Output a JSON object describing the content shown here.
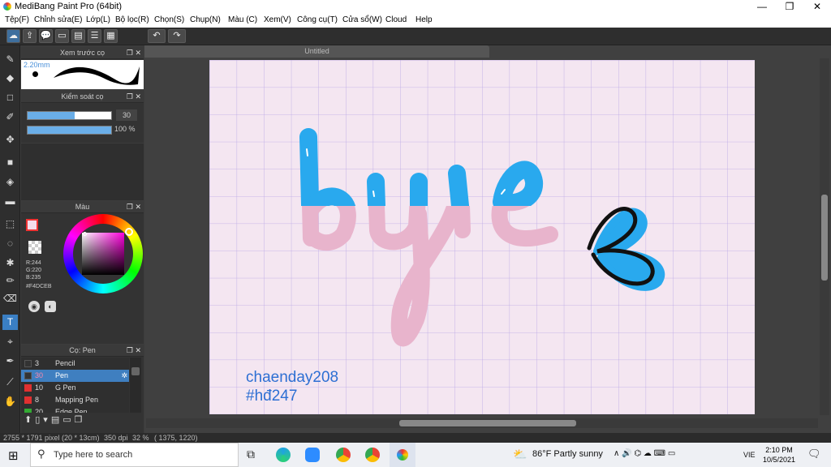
{
  "window": {
    "title": "MediBang Paint Pro (64bit)",
    "controls": [
      "—",
      "❐",
      "✕"
    ]
  },
  "menu": [
    "Tệp(F)",
    "Chỉnh sửa(E)",
    "Lớp(L)",
    "Bộ lọc(R)",
    "Chọn(S)",
    "Chụp(N)",
    "Màu (C)",
    "Xem(V)",
    "Công cụ(T)",
    "Cửa sổ(W)",
    "Cloud",
    "Help"
  ],
  "toolbar": {
    "undo_icon": "undo-icon",
    "redo_icon": "redo-icon"
  },
  "brush_preview": {
    "title": "Xem trước cọ",
    "size": "2.20mm"
  },
  "brush_control": {
    "title": "Kiểm soát cọ",
    "size_value": "30",
    "opacity_value": "100 %",
    "size_fraction": 0.56,
    "opacity_fraction": 1.0
  },
  "color_panel": {
    "title": "Màu",
    "r": "R:244",
    "g": "G:220",
    "b": "B:235",
    "hex": "#F4DCEB",
    "current_color": "#F4DCEB"
  },
  "brush_list": {
    "title": "Cọ: Pen",
    "items": [
      {
        "num": "3",
        "name": "Pencil",
        "color": "#333333"
      },
      {
        "num": "30",
        "name": "Pen",
        "color": "#333333",
        "selected": true
      },
      {
        "num": "10",
        "name": "G Pen",
        "color": "#e03030"
      },
      {
        "num": "8",
        "name": "Mapping Pen",
        "color": "#e03030"
      },
      {
        "num": "20",
        "name": "Edge Pen",
        "color": "#33aa33"
      }
    ]
  },
  "document": {
    "tab": "Untitled",
    "handwriting": "bye",
    "annotation_line1": "chaenday208",
    "annotation_line2": "#hđ247"
  },
  "status": {
    "size": "2755 * 1791 pixel",
    "cm": "(20 * 13cm)",
    "dpi": "350 dpi",
    "zoom": "32 %",
    "coords": "( 1375, 1220)"
  },
  "taskbar": {
    "search_placeholder": "Type here to search",
    "weather": "86°F  Partly sunny",
    "lang": "VIE",
    "time": "2:10 PM",
    "date": "10/5/2021"
  }
}
